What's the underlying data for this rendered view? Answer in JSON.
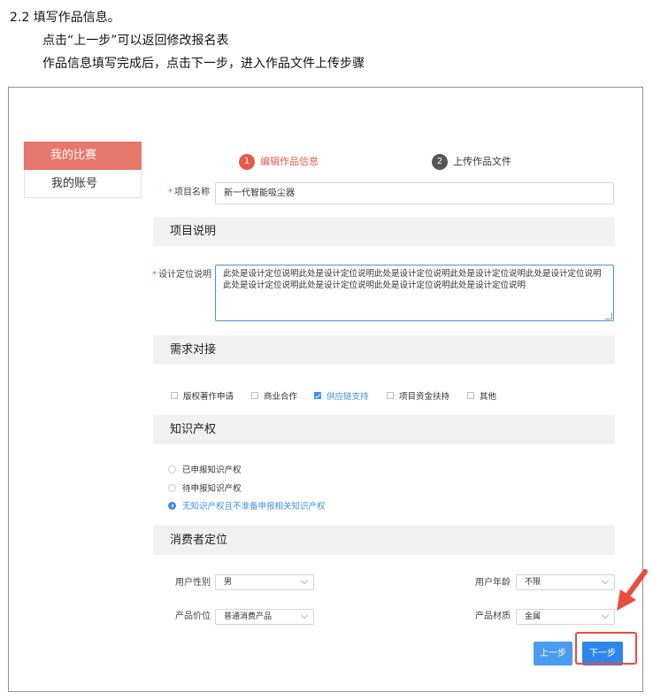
{
  "doc": {
    "heading": "2.2  填写作品信息。",
    "line1": "点击“上一步”可以返回修改报名表",
    "line2": "作品信息填写完成后，点击下一步，进入作品文件上传步骤"
  },
  "sidebar": {
    "items": [
      {
        "label": "我的比赛"
      },
      {
        "label": "我的账号"
      }
    ]
  },
  "steps": [
    {
      "num": "1",
      "label": "编辑作品信息"
    },
    {
      "num": "2",
      "label": "上传作品文件"
    }
  ],
  "form": {
    "required_mark": "*",
    "project_name_label": "项目名称",
    "project_name_value": "新一代智能吸尘器",
    "section_desc": "项目说明",
    "design_label": "设计定位说明",
    "design_value": "此处是设计定位说明此处是设计定位说明此处是设计定位说明此处是设计定位说明此处是设计定位说明此处是设计定位说明此处是设计定位说明此处是设计定位说明此处是设计定位说明",
    "section_demand": "需求对接",
    "demand_options": [
      {
        "label": "版权著作申请",
        "checked": false
      },
      {
        "label": "商业合作",
        "checked": false
      },
      {
        "label": "供应链支持",
        "checked": true
      },
      {
        "label": "项目资金扶持",
        "checked": false
      },
      {
        "label": "其他",
        "checked": false
      }
    ],
    "section_ip": "知识产权",
    "ip_options": [
      {
        "label": "已申报知识产权",
        "selected": false
      },
      {
        "label": "待申报知识产权",
        "selected": false
      },
      {
        "label": "无知识产权且不准备申报相关知识产权",
        "selected": true
      }
    ],
    "section_consumer": "消费者定位",
    "gender_label": "用户性别",
    "gender_value": "男",
    "age_label": "用户年龄",
    "age_value": "不限",
    "price_label": "产品价位",
    "price_value": "普通消费产品",
    "material_label": "产品材质",
    "material_value": "金属"
  },
  "buttons": {
    "prev": "上一步",
    "next": "下一步"
  },
  "colors": {
    "accent_red": "#e8776b",
    "primary_blue": "#2e86ea",
    "highlight": "#e94c3d"
  }
}
